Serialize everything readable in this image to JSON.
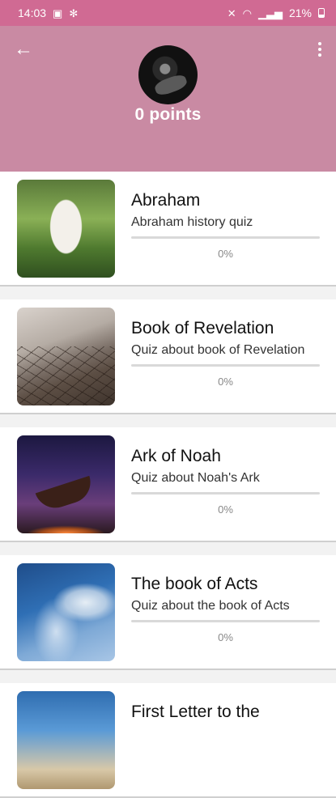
{
  "status": {
    "time": "14:03",
    "battery": "21%"
  },
  "header": {
    "points": "0 points"
  },
  "quizzes": [
    {
      "title": "Abraham",
      "subtitle": "Abraham history quiz",
      "progress_percent": 0,
      "progress_label": "0%"
    },
    {
      "title": "Book of Revelation",
      "subtitle": "Quiz about book of Revelation",
      "progress_percent": 0,
      "progress_label": "0%"
    },
    {
      "title": "Ark of Noah",
      "subtitle": "Quiz about Noah's Ark",
      "progress_percent": 0,
      "progress_label": "0%"
    },
    {
      "title": "The book of Acts",
      "subtitle": "Quiz about the book of Acts",
      "progress_percent": 0,
      "progress_label": "0%"
    },
    {
      "title": "First Letter to the",
      "subtitle": "",
      "progress_percent": 0,
      "progress_label": ""
    }
  ],
  "colors": {
    "status_bar": "#d06a93",
    "header": "#c98aa3"
  },
  "icons": {
    "back": "arrow-left-icon",
    "menu": "more-vert-icon",
    "status": [
      "image-icon",
      "settings-icon",
      "mute-icon",
      "wifi-icon",
      "signal-icon",
      "battery-icon"
    ]
  }
}
